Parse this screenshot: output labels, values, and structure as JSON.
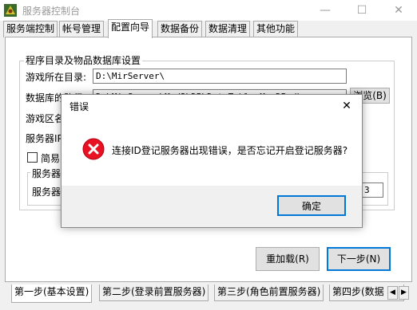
{
  "window": {
    "title": "服务器控制台",
    "minimize_glyph": "—",
    "maximize_glyph": "☐",
    "close_glyph": "✕"
  },
  "main_tabs": [
    "服务端控制",
    "帐号管理",
    "配置向导",
    "数据备份",
    "数据清理",
    "其他功能"
  ],
  "main_tab_active": 2,
  "config": {
    "group_title": "程序目录及物品数据库设置",
    "game_dir_label": "游戏所在目录:",
    "game_dir_value": "D:\\MirServer\\",
    "db_path_label": "数据库的路径:",
    "db_path_value": "D:\\MirServer\\Mud2\\DB\\DataTable.MyaDB.db",
    "browse_label": "浏览(B)",
    "zone_label": "游戏区名",
    "server_label": "服务器IP",
    "simple_label": "简易",
    "server_group_title": "服务器",
    "server_name_label": "服务器",
    "small_field_value": "3"
  },
  "buttons": {
    "reload": "重加载(R)",
    "next": "下一步(N)"
  },
  "bottom_tabs": [
    "第一步(基本设置)",
    "第二步(登录前置服务器)",
    "第三步(角色前置服务器)",
    "第四步(数据"
  ],
  "bottom_tab_active": 0,
  "dialog": {
    "title": "错误",
    "message": "连接ID登记服务器出现错误，是否忘记开启登记服务器?",
    "ok_label": "确定",
    "close_glyph": "✕"
  },
  "icons": {
    "app": "app-icon",
    "error": "error-icon"
  }
}
